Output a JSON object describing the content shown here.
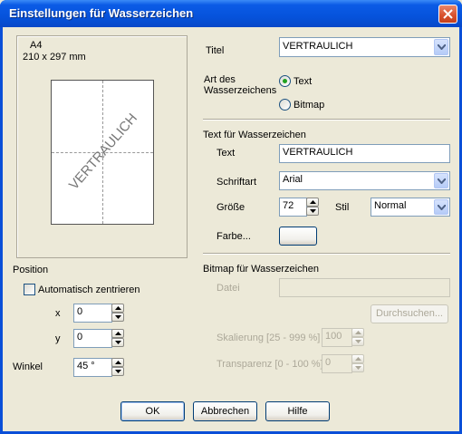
{
  "window": {
    "title": "Einstellungen für Wasserzeichen"
  },
  "preview": {
    "paper_name": "A4",
    "paper_size": "210 x 297 mm",
    "watermark_text": "VERTRAULICH"
  },
  "title_field": {
    "label": "Titel",
    "value": "VERTRAULICH"
  },
  "type": {
    "label": "Art des Wasserzeichens",
    "options": [
      "Text",
      "Bitmap"
    ],
    "selected": "Text"
  },
  "text_group": {
    "heading": "Text für Wasserzeichen",
    "text_label": "Text",
    "text_value": "VERTRAULICH",
    "font_label": "Schriftart",
    "font_value": "Arial",
    "size_label": "Größe",
    "size_value": "72",
    "style_label": "Stil",
    "style_value": "Normal",
    "color_label": "Farbe..."
  },
  "bitmap_group": {
    "heading": "Bitmap für Wasserzeichen",
    "file_label": "Datei",
    "file_value": "",
    "browse_label": "Durchsuchen...",
    "scale_label": "Skalierung [25 - 999 %]",
    "scale_value": "100",
    "transparency_label": "Transparenz [0 - 100 %]",
    "transparency_value": "0"
  },
  "position": {
    "heading": "Position",
    "auto_center_label": "Automatisch zentrieren",
    "auto_center_checked": false,
    "x_label": "x",
    "x_value": "0",
    "y_label": "y",
    "y_value": "0",
    "angle_label": "Winkel",
    "angle_value": "45 °"
  },
  "buttons": {
    "ok": "OK",
    "cancel": "Abbrechen",
    "help": "Hilfe"
  },
  "colors": {
    "titlebar": "#0653dc",
    "dialog_bg": "#ece9d8",
    "radio_dot": "#21a121"
  }
}
